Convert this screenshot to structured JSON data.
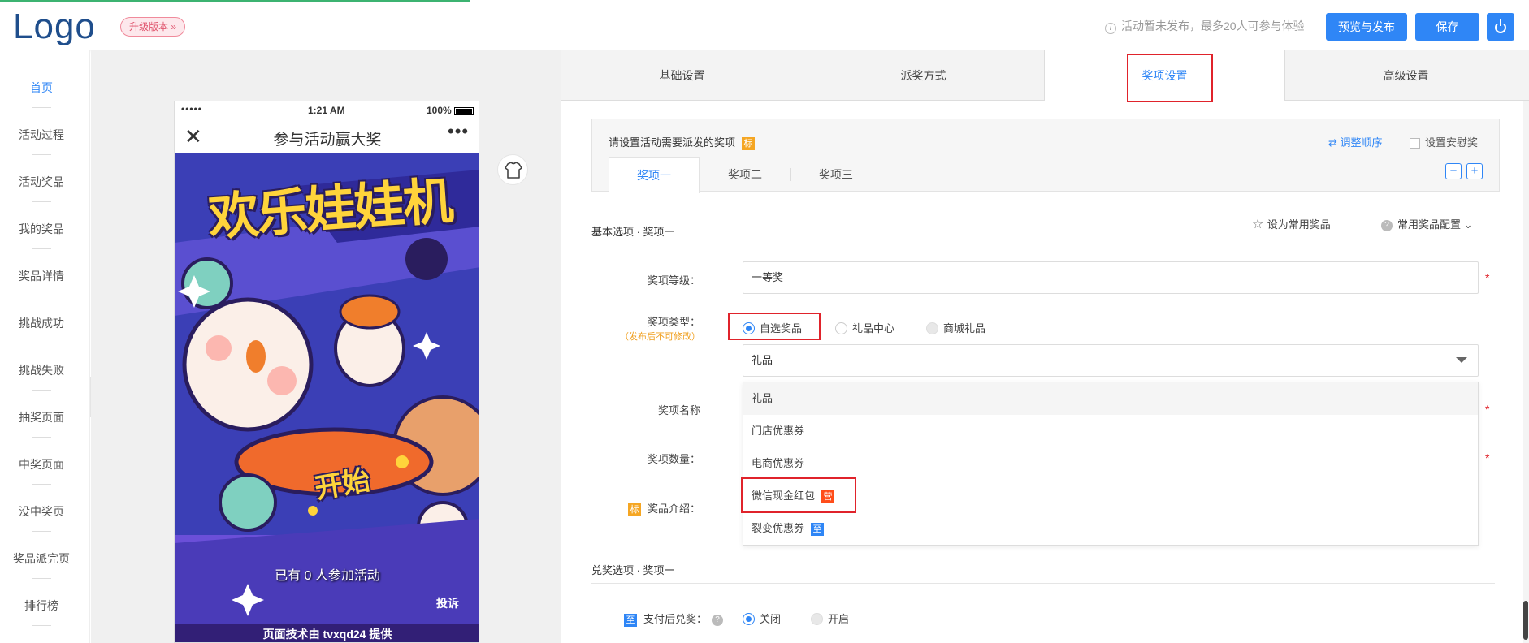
{
  "header": {
    "logo": "Logo",
    "upgrade_label": "升级版本 »",
    "notice": "活动暂未发布，最多20人可参与体验",
    "preview_publish": "预览与发布",
    "save": "保存",
    "power_icon": "power-icon"
  },
  "sidebar": {
    "items": [
      {
        "label": "首页",
        "active": true
      },
      {
        "label": "活动过程"
      },
      {
        "label": "活动奖品"
      },
      {
        "label": "我的奖品"
      },
      {
        "label": "奖品详情"
      },
      {
        "label": "挑战成功"
      },
      {
        "label": "挑战失败"
      },
      {
        "label": "抽奖页面"
      },
      {
        "label": "中奖页面"
      },
      {
        "label": "没中奖页"
      },
      {
        "label": "奖品派完页"
      },
      {
        "label": "排行榜"
      }
    ],
    "collapse_glyph": "«"
  },
  "phone": {
    "signal": "•••••",
    "time": "1:21 AM",
    "battery": "100%",
    "nav_close": "✕",
    "nav_title": "参与活动赢大奖",
    "nav_more": "•••",
    "poster_title": "欢乐娃娃机",
    "start_label": "开始",
    "joined_text": "已有 0 人参加活动",
    "report": "投诉",
    "credit": "页面技术由 tvxqd24 提供"
  },
  "tabs": [
    "基础设置",
    "派奖方式",
    "奖项设置",
    "高级设置"
  ],
  "active_tab": "奖项设置",
  "prize_panel": {
    "title": "请设置活动需要派发的奖项",
    "title_tag": "标",
    "adjust_order": "调整顺序",
    "consolation": "设置安慰奖",
    "prize_tabs": [
      "奖项一",
      "奖项二",
      "奖项三"
    ],
    "minus": "−",
    "plus": "+"
  },
  "basic_section": {
    "title": "基本选项 · 奖项一",
    "set_common": "设为常用奖品",
    "common_config": "常用奖品配置"
  },
  "form": {
    "level_label": "奖项等级：",
    "level_value": "一等奖",
    "type_label": "奖项类型：",
    "type_note": "（发布后不可修改）",
    "type_options": [
      "自选奖品",
      "礼品中心",
      "商城礼品"
    ],
    "type_selected": "自选奖品",
    "select_value": "礼品",
    "name_label": "奖项名称",
    "qty_label": "奖项数量：",
    "intro_tag": "标",
    "intro_label": "奖品介绍：",
    "required_mark": "*"
  },
  "dropdown": {
    "options": [
      {
        "label": "礼品",
        "selected": true
      },
      {
        "label": "门店优惠券"
      },
      {
        "label": "电商优惠券"
      },
      {
        "label": "微信现金红包",
        "badge": "营",
        "badge_color": "#ff4d1a"
      },
      {
        "label": "裂变优惠券",
        "badge": "至",
        "badge_color": "#2f86f6"
      }
    ]
  },
  "redeem_section": {
    "title": "兑奖选项 · 奖项一",
    "tag": "至",
    "pay_label": "支付后兑奖：",
    "help": "?",
    "options": [
      "关闭",
      "开启"
    ],
    "selected": "关闭"
  },
  "colors": {
    "primary": "#2f86f6",
    "highlight": "#e0232b",
    "logo": "#1f4e8c"
  }
}
